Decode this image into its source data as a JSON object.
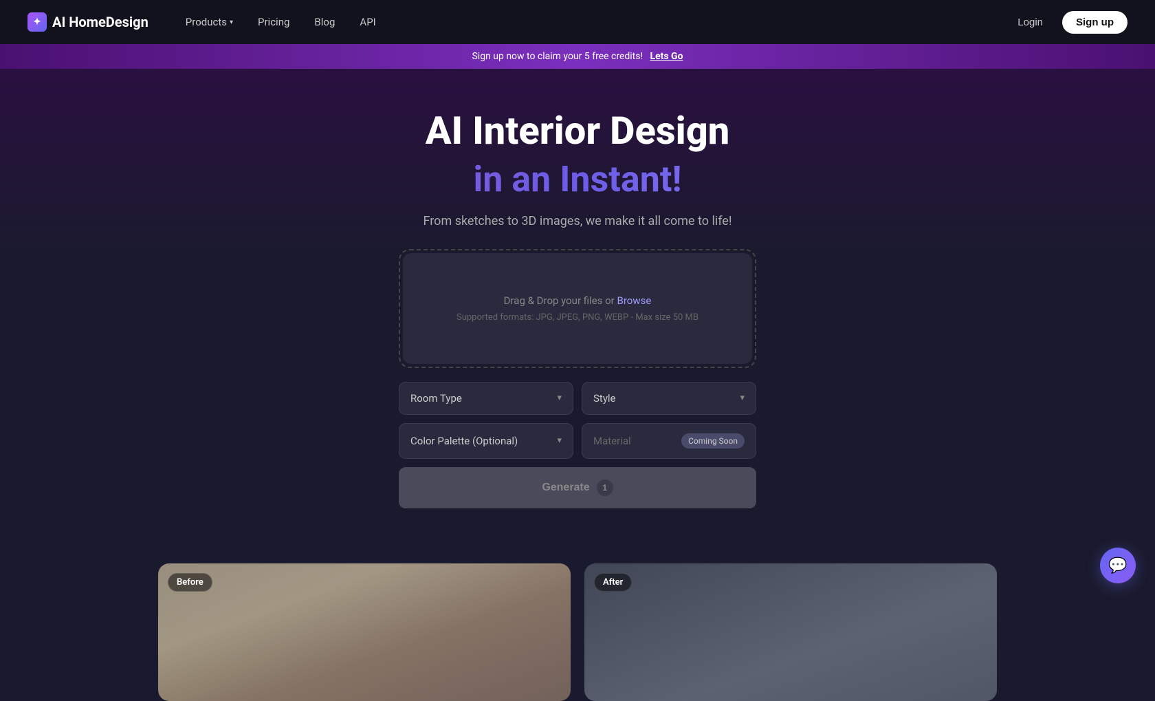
{
  "navbar": {
    "logo_text": "AI HomeDesign",
    "logo_icon": "✦",
    "nav_items": [
      {
        "label": "Products",
        "has_chevron": true
      },
      {
        "label": "Pricing",
        "has_chevron": false
      },
      {
        "label": "Blog",
        "has_chevron": false
      },
      {
        "label": "API",
        "has_chevron": false
      }
    ],
    "login_label": "Login",
    "signup_label": "Sign up"
  },
  "banner": {
    "text": "Sign up now to claim your 5 free credits!",
    "cta": "Lets Go"
  },
  "hero": {
    "heading1": "AI Interior Design",
    "heading2": "in an Instant!",
    "subtitle": "From sketches to 3D images, we make it all come to life!"
  },
  "upload": {
    "drag_text": "Drag & Drop your files or ",
    "browse_text": "Browse",
    "formats_text": "Supported formats: JPG, JPEG, PNG, WEBP - Max size 50 MB"
  },
  "controls": {
    "room_type_label": "Room Type",
    "style_label": "Style",
    "color_palette_label": "Color Palette (Optional)",
    "material_placeholder": "Material",
    "coming_soon_badge": "Coming Soon"
  },
  "generate": {
    "label": "Generate",
    "credit_count": "1"
  },
  "before_after": {
    "before_label": "Before",
    "after_label": "After"
  }
}
